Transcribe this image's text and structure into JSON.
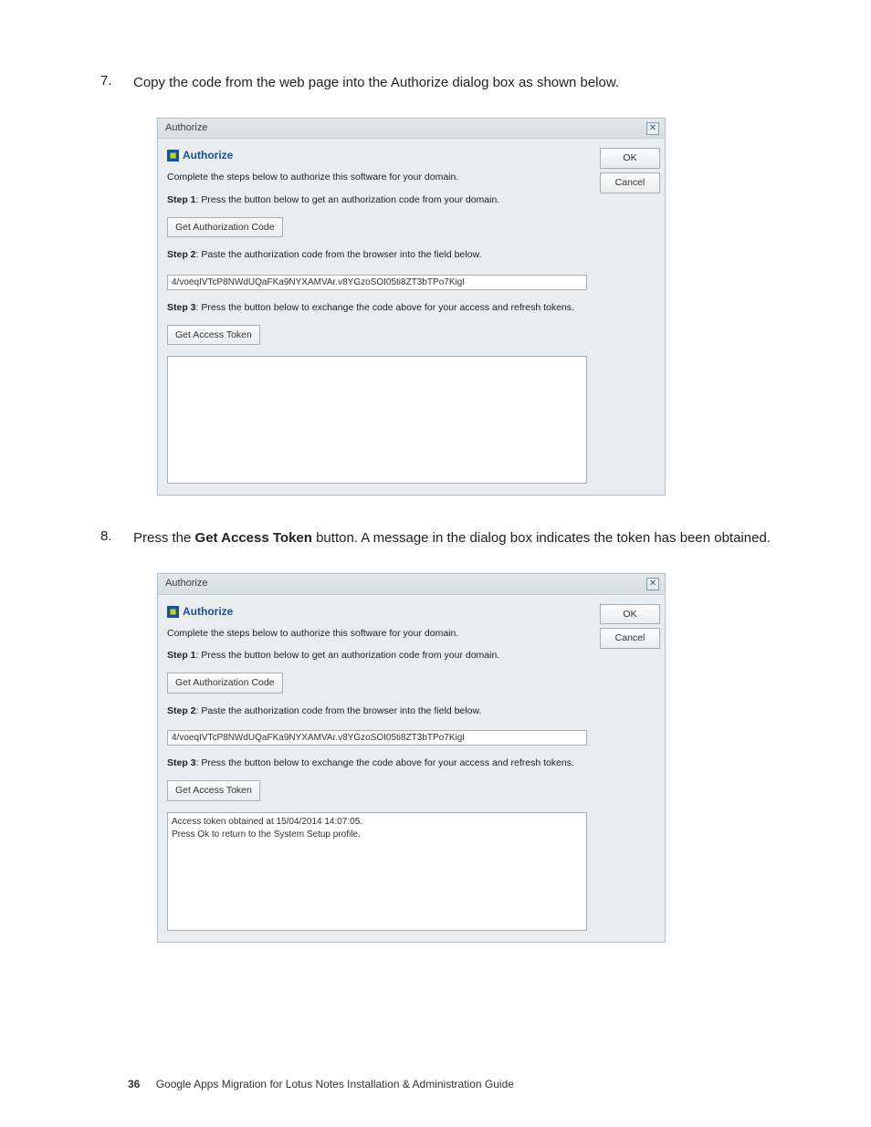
{
  "steps": {
    "item7": {
      "number": "7.",
      "text": "Copy the code from the web page into the Authorize dialog box as shown below."
    },
    "item8": {
      "number": "8.",
      "prefix": "Press the ",
      "bold": "Get Access Token",
      "suffix": " button. A message in the dialog box indicates the token has been obtained."
    }
  },
  "dialog": {
    "title": "Authorize",
    "close_glyph": "✕",
    "heading": "Authorize",
    "intro": "Complete the steps below to authorize this software for your domain.",
    "step1_label": "Step 1",
    "step1_text": ": Press the button below to get an authorization code from your domain.",
    "btn_get_auth": "Get Authorization Code",
    "step2_label": "Step 2",
    "step2_text": ": Paste the authorization code from the browser into the field below.",
    "code_value": "4/voeqIVTcP8NWdUQaFKa9NYXAMVAr.v8YGzoSOI05ti8ZT3bTPo7KigI",
    "step3_label": "Step 3",
    "step3_text": ": Press the button below to exchange the code above for your access and refresh tokens.",
    "btn_get_token": "Get Access Token",
    "ok": "OK",
    "cancel": "Cancel",
    "output_empty": "",
    "output_filled": "Access token obtained at 15/04/2014 14:07:05.\nPress Ok to return to the System Setup profile."
  },
  "footer": {
    "page": "36",
    "title": "Google Apps Migration for Lotus Notes Installation & Administration Guide"
  }
}
